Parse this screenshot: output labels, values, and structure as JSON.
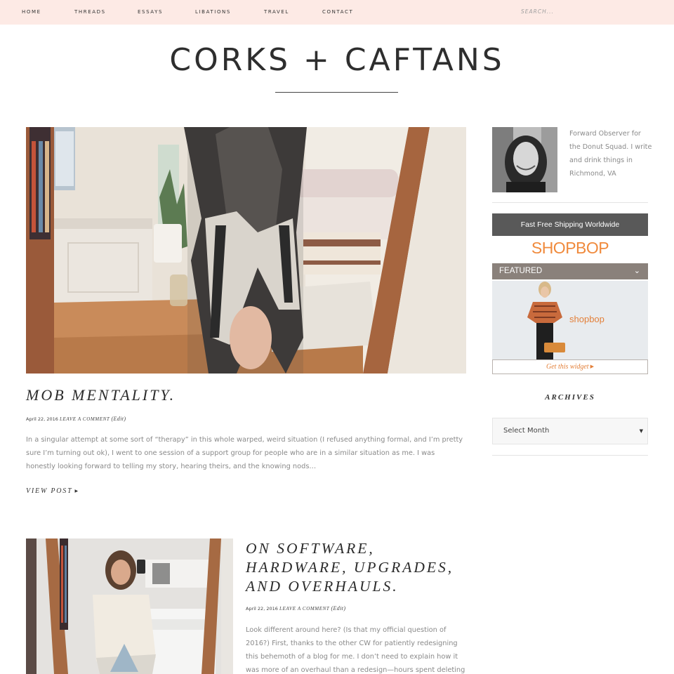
{
  "nav": {
    "items": [
      "HOME",
      "THREADS",
      "ESSAYS",
      "LIBATIONS",
      "TRAVEL",
      "CONTACT"
    ],
    "search_placeholder": "SEARCH..."
  },
  "site": {
    "title": "CORKS + CAFTANS"
  },
  "posts": [
    {
      "title": "MOB MENTALITY.",
      "date": "April 22, 2016",
      "comment_link": "Leave a comment",
      "edit_link": "(Edit)",
      "excerpt": "In a singular attempt at some sort of “therapy” in this whole warped, weird situation (I refused anything formal, and I’m pretty sure I’m turning out ok), I went to one session of a support group for people who are in a similar situation as me. I was honestly looking forward to telling my story, hearing theirs, and the knowing nods…",
      "view_post": "VIEW POST"
    },
    {
      "title": "ON SOFTWARE, HARDWARE, UPGRADES, AND OVERHAULS.",
      "date": "April 22, 2016",
      "comment_link": "Leave a comment",
      "edit_link": "(Edit)",
      "excerpt": "Look different around here? (Is that my official question of 2016?) First, thanks to the other CW for patiently redesigning this behemoth of a blog for me. I don’t need to explain how it was more of an overhaul than a redesign—hours spent deleting"
    }
  ],
  "sidebar": {
    "bio": "Forward Observer for the Donut Squad. I write and drink things in Richmond, VA",
    "shipping": "Fast Free Shipping Worldwide",
    "shopbop_logo": "SHOPBOP",
    "featured_label": "FEATURED",
    "featured_brand": "shopbop",
    "widget_link": "Get this widget",
    "archives_title": "ARCHIVES",
    "archives_select": "Select Month"
  },
  "icons": {
    "view_post_arrow": "triangle-right-icon",
    "featured_chevron": "chevron-down-icon",
    "select_caret": "caret-down-icon"
  },
  "colors": {
    "nav_bg": "#fdeae5",
    "shopbop_orange": "#f08a3c",
    "ship_bar": "#595959",
    "featured_bar": "#8a817b"
  }
}
